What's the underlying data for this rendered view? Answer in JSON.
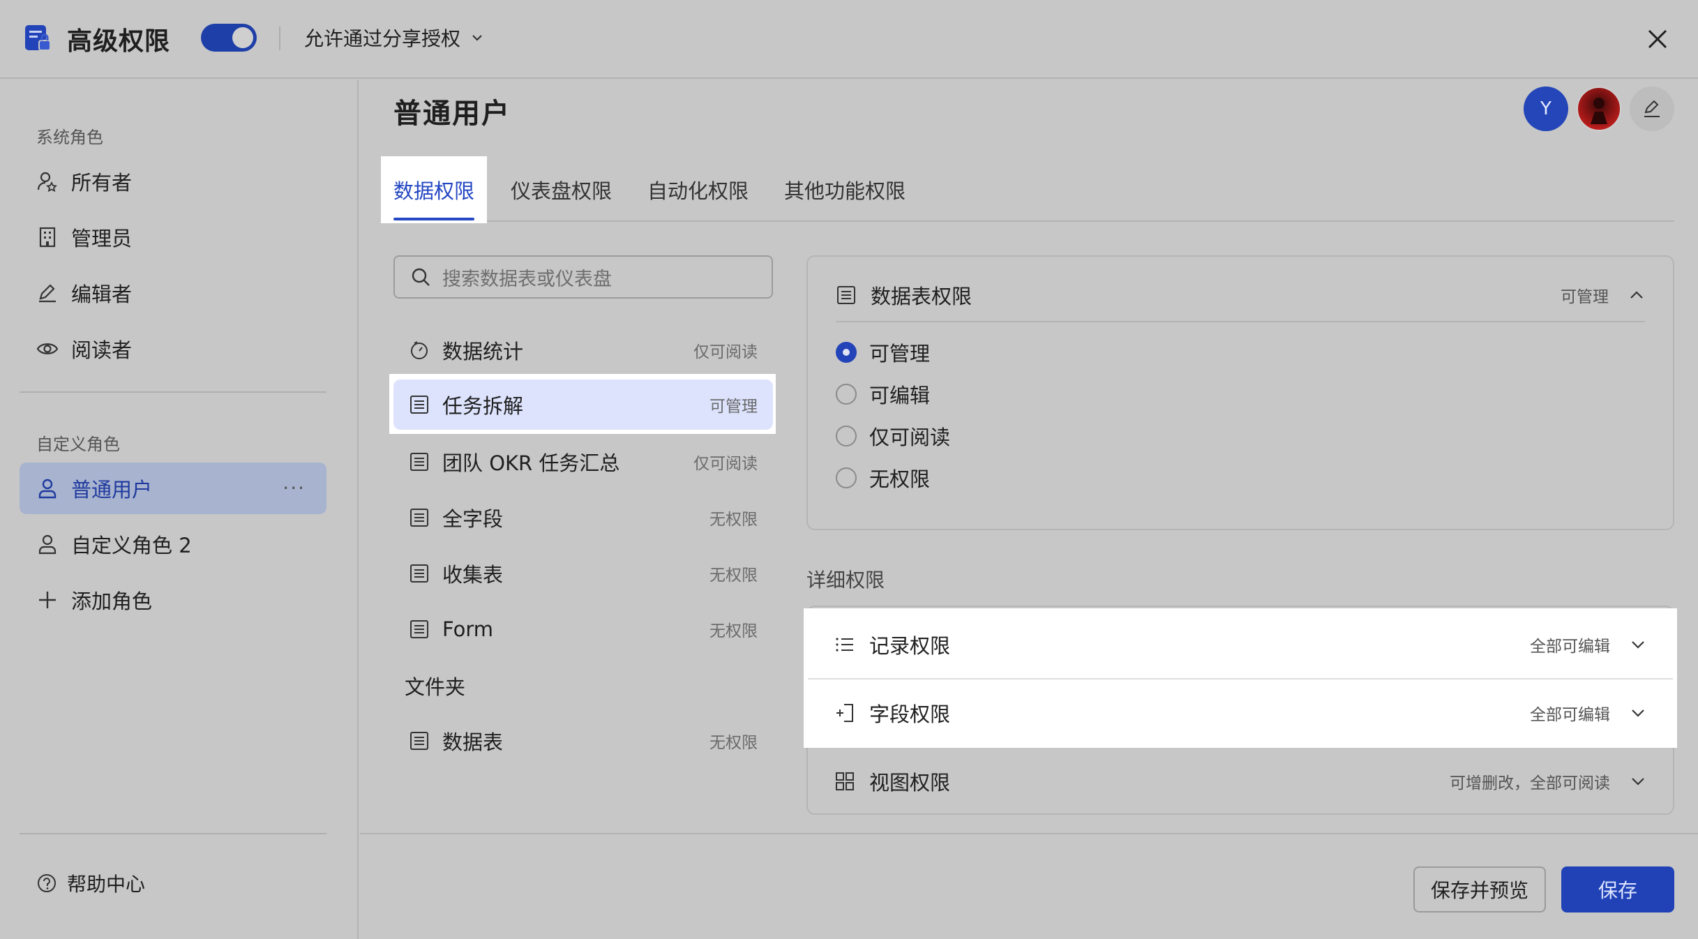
{
  "header": {
    "title": "高级权限",
    "toggle_on": true,
    "share_option": "允许通过分享授权"
  },
  "sidebar": {
    "system_section": "系统角色",
    "system_roles": [
      "所有者",
      "管理员",
      "编辑者",
      "阅读者"
    ],
    "custom_section": "自定义角色",
    "custom_roles": [
      "普通用户",
      "自定义角色 2"
    ],
    "more": "···",
    "add_role": "添加角色",
    "help": "帮助中心"
  },
  "main": {
    "role_title": "普通用户",
    "avatar_initial": "Y",
    "tabs": [
      "数据权限",
      "仪表盘权限",
      "自动化权限",
      "其他功能权限"
    ],
    "search_placeholder": "搜索数据表或仪表盘",
    "tables": [
      {
        "name": "数据统计",
        "perm": "仅可阅读",
        "icon": "dashboard-icon"
      },
      {
        "name": "任务拆解",
        "perm": "可管理",
        "icon": "table-icon"
      },
      {
        "name": "团队 OKR 任务汇总",
        "perm": "仅可阅读",
        "icon": "table-icon"
      },
      {
        "name": "全字段",
        "perm": "无权限",
        "icon": "table-icon"
      },
      {
        "name": "收集表",
        "perm": "无权限",
        "icon": "table-icon"
      },
      {
        "name": "Form",
        "perm": "无权限",
        "icon": "table-icon"
      }
    ],
    "folder": "文件夹",
    "folder_tables": [
      {
        "name": "数据表",
        "perm": "无权限",
        "icon": "table-icon"
      }
    ]
  },
  "panel": {
    "table_perm_title": "数据表权限",
    "table_perm_value": "可管理",
    "options": [
      "可管理",
      "可编辑",
      "仅可阅读",
      "无权限"
    ],
    "selected_option": 0,
    "detail_title": "详细权限",
    "detail_rows": [
      {
        "label": "记录权限",
        "value": "全部可编辑"
      },
      {
        "label": "字段权限",
        "value": "全部可编辑"
      },
      {
        "label": "视图权限",
        "value": "可增删改，全部可阅读"
      }
    ]
  },
  "footer": {
    "save_preview": "保存并预览",
    "save": "保存"
  },
  "colors": {
    "accent": "#2244b8",
    "selected_bg": "#dde3fd"
  }
}
